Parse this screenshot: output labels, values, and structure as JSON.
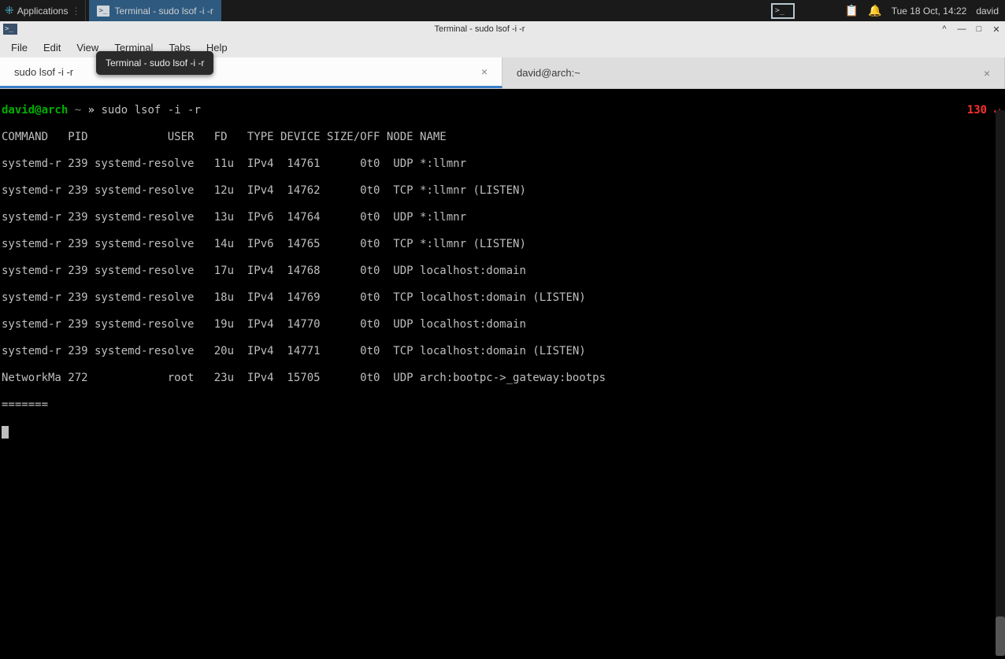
{
  "panel": {
    "applications_label": "Applications",
    "taskbar_item": "Terminal - sudo lsof -i -r",
    "clock": "Tue 18 Oct, 14:22",
    "username": "david"
  },
  "window": {
    "title": "Terminal - sudo lsof -i -r",
    "tooltip_title": "Terminal - sudo lsof -i -r"
  },
  "menubar": {
    "items": [
      "File",
      "Edit",
      "View",
      "Terminal",
      "Tabs",
      "Help"
    ]
  },
  "tabs": [
    {
      "label": "sudo lsof -i -r",
      "active": true
    },
    {
      "label": "david@arch:~",
      "active": false
    }
  ],
  "prompt": {
    "user_host": "david@arch",
    "path": "~",
    "symbol": "»",
    "command": "sudo lsof -i -r",
    "exit_code": "130",
    "return_glyph": "↵"
  },
  "output": {
    "header": "COMMAND   PID            USER   FD   TYPE DEVICE SIZE/OFF NODE NAME",
    "rows": [
      "systemd-r 239 systemd-resolve   11u  IPv4  14761      0t0  UDP *:llmnr",
      "systemd-r 239 systemd-resolve   12u  IPv4  14762      0t0  TCP *:llmnr (LISTEN)",
      "systemd-r 239 systemd-resolve   13u  IPv6  14764      0t0  UDP *:llmnr",
      "systemd-r 239 systemd-resolve   14u  IPv6  14765      0t0  TCP *:llmnr (LISTEN)",
      "systemd-r 239 systemd-resolve   17u  IPv4  14768      0t0  UDP localhost:domain",
      "systemd-r 239 systemd-resolve   18u  IPv4  14769      0t0  TCP localhost:domain (LISTEN)",
      "systemd-r 239 systemd-resolve   19u  IPv4  14770      0t0  UDP localhost:domain",
      "systemd-r 239 systemd-resolve   20u  IPv4  14771      0t0  TCP localhost:domain (LISTEN)",
      "NetworkMa 272            root   23u  IPv4  15705      0t0  UDP arch:bootpc->_gateway:bootps"
    ],
    "separator": "======="
  }
}
